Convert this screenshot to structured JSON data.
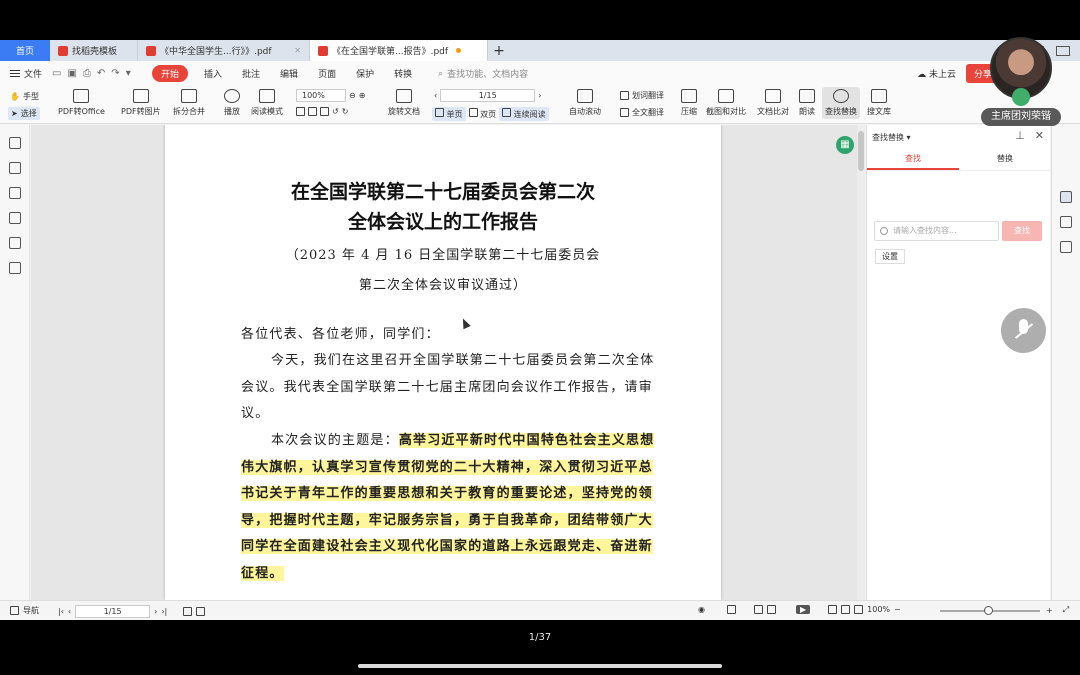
{
  "tabs": [
    {
      "label": "首页"
    },
    {
      "label": "找稻壳模板"
    },
    {
      "label": "《中华全国学生...行》》.pdf"
    },
    {
      "label": "《在全国学联第...报告》.pdf"
    }
  ],
  "menu": {
    "file": "文件",
    "items": [
      "开始",
      "插入",
      "批注",
      "编辑",
      "页面",
      "保护",
      "转换"
    ],
    "search_placeholder": "查找功能、文档内容",
    "cloud": "未上云",
    "share": "分享"
  },
  "ribbon": {
    "hand": "手型",
    "select": "选择",
    "pdf_to_office": "PDF转Office",
    "pdf_to_image": "PDF转图片",
    "split_merge": "拆分合并",
    "play": "播放",
    "read_mode": "阅读模式",
    "zoom": "100%",
    "page": "1/15",
    "rotate_doc": "旋转文档",
    "single_page": "单页",
    "double_page": "双页",
    "continuous": "连续阅读",
    "auto_scroll": "自动滚动",
    "word_translate": "划词翻译",
    "full_translate": "全文翻译",
    "compress": "压缩",
    "screenshot_compare": "截图和对比",
    "doc_compare": "文档比对",
    "read_aloud": "朗读",
    "find_replace": "查找替换",
    "search_library": "搜文库"
  },
  "document": {
    "title_line1": "在全国学联第二十七届委员会第二次",
    "title_line2": "全体会议上的工作报告",
    "sub_line1": "（2023 年 4 月 16 日全国学联第二十七届委员会",
    "sub_line2": "第二次全体会议审议通过）",
    "salutation": "各位代表、各位老师，同学们：",
    "para1": "今天，我们在这里召开全国学联第二十七届委员会第二次全体会议。我代表全国学联第二十七届主席团向会议作工作报告，请审议。",
    "para2_lead": "本次会议的主题是：",
    "para2_highlight": "高举习近平新时代中国特色社会主义思想伟大旗帜，认真学习宣传贯彻党的二十大精神，深入贯彻习近平总书记关于青年工作的重要思想和关于教育的重要论述，坚持党的领导，把握时代主题，牢记服务宗旨，勇于自我革命，团结带领广大同学在全面建设社会主义现代化国家的道路上永远跟党走、奋进新征程。"
  },
  "find_panel": {
    "title": "查找替换",
    "tab_find": "查找",
    "tab_replace": "替换",
    "input_placeholder": "请输入查找内容...",
    "find_button": "查找",
    "settings": "设置"
  },
  "status": {
    "nav": "导航",
    "page": "1/15",
    "zoom": "100%"
  },
  "overlay": {
    "host_label": "主席团刘荣锴",
    "page_indicator": "1/37"
  },
  "colors": {
    "accent": "#e8443a",
    "highlight": "#fff59a",
    "home_tab": "#3b7cf5"
  }
}
